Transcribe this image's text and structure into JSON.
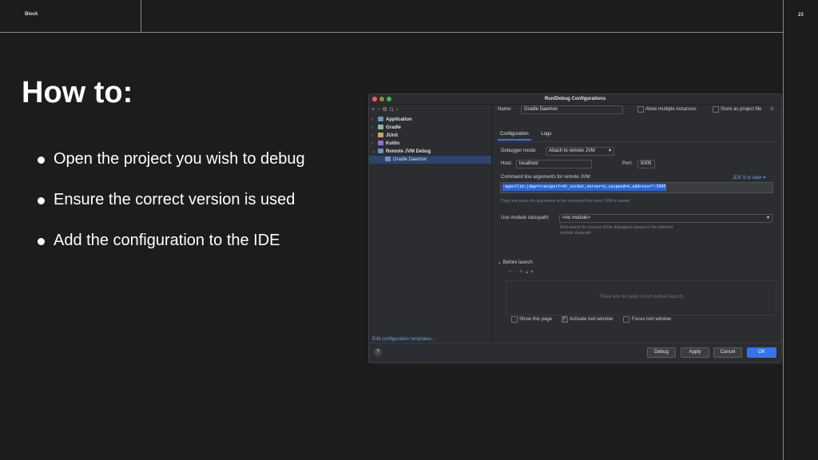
{
  "slide": {
    "logo": "Block",
    "page_number": "23",
    "title": "How to:",
    "bullets": [
      "Open the project you wish to debug",
      "Ensure the correct version is used",
      "Add the configuration to the IDE"
    ]
  },
  "dialog": {
    "title": "Run/Debug Configurations",
    "tree": [
      {
        "label": "Application",
        "icon_color": "#6897bb"
      },
      {
        "label": "Gradle",
        "icon_color": "#8ab6a6"
      },
      {
        "label": "JUnit",
        "icon_color": "#c7a566"
      },
      {
        "label": "Kotlin",
        "icon_color": "#9e6ad6"
      },
      {
        "label": "Remote JVM Debug",
        "icon_color": "#6897bb"
      },
      {
        "label": "Gradle Daemon",
        "icon_color": "#6897bb"
      }
    ],
    "edit_templates_link": "Edit configuration templates...",
    "name_label": "Name:",
    "name_value": "Gradle Daemon",
    "allow_multiple": "Allow multiple instances",
    "store_as_file": "Store as project file",
    "tabs": [
      "Configuration",
      "Logs"
    ],
    "debugger_mode_label": "Debugger mode:",
    "debugger_mode_value": "Attach to remote JVM",
    "host_label": "Host:",
    "host_value": "localhost",
    "port_label": "Port:",
    "port_value": "5005",
    "cmd_args_label": "Command line arguments for remote JVM:",
    "jdk_link": "JDK 9 or later",
    "cmd_args_value": "-agentlib:jdwp=transport=dt_socket,server=y,suspend=n,address=*:5005",
    "cmd_hint": "Copy and paste the arguments to the command line when JVM is started",
    "module_label": "Use module classpath:",
    "module_value": "<no module>",
    "module_hint_1": "First search for sources of the debugged classes in the selected",
    "module_hint_2": "module classpath",
    "before_launch": "Before launch",
    "before_launch_empty": "There are no tasks to run before launch",
    "show_page": "Show this page",
    "activate_tool": "Activate tool window",
    "focus_tool": "Focus tool window",
    "buttons": {
      "debug": "Debug",
      "apply": "Apply",
      "cancel": "Cancel",
      "ok": "OK"
    },
    "help": "?"
  }
}
